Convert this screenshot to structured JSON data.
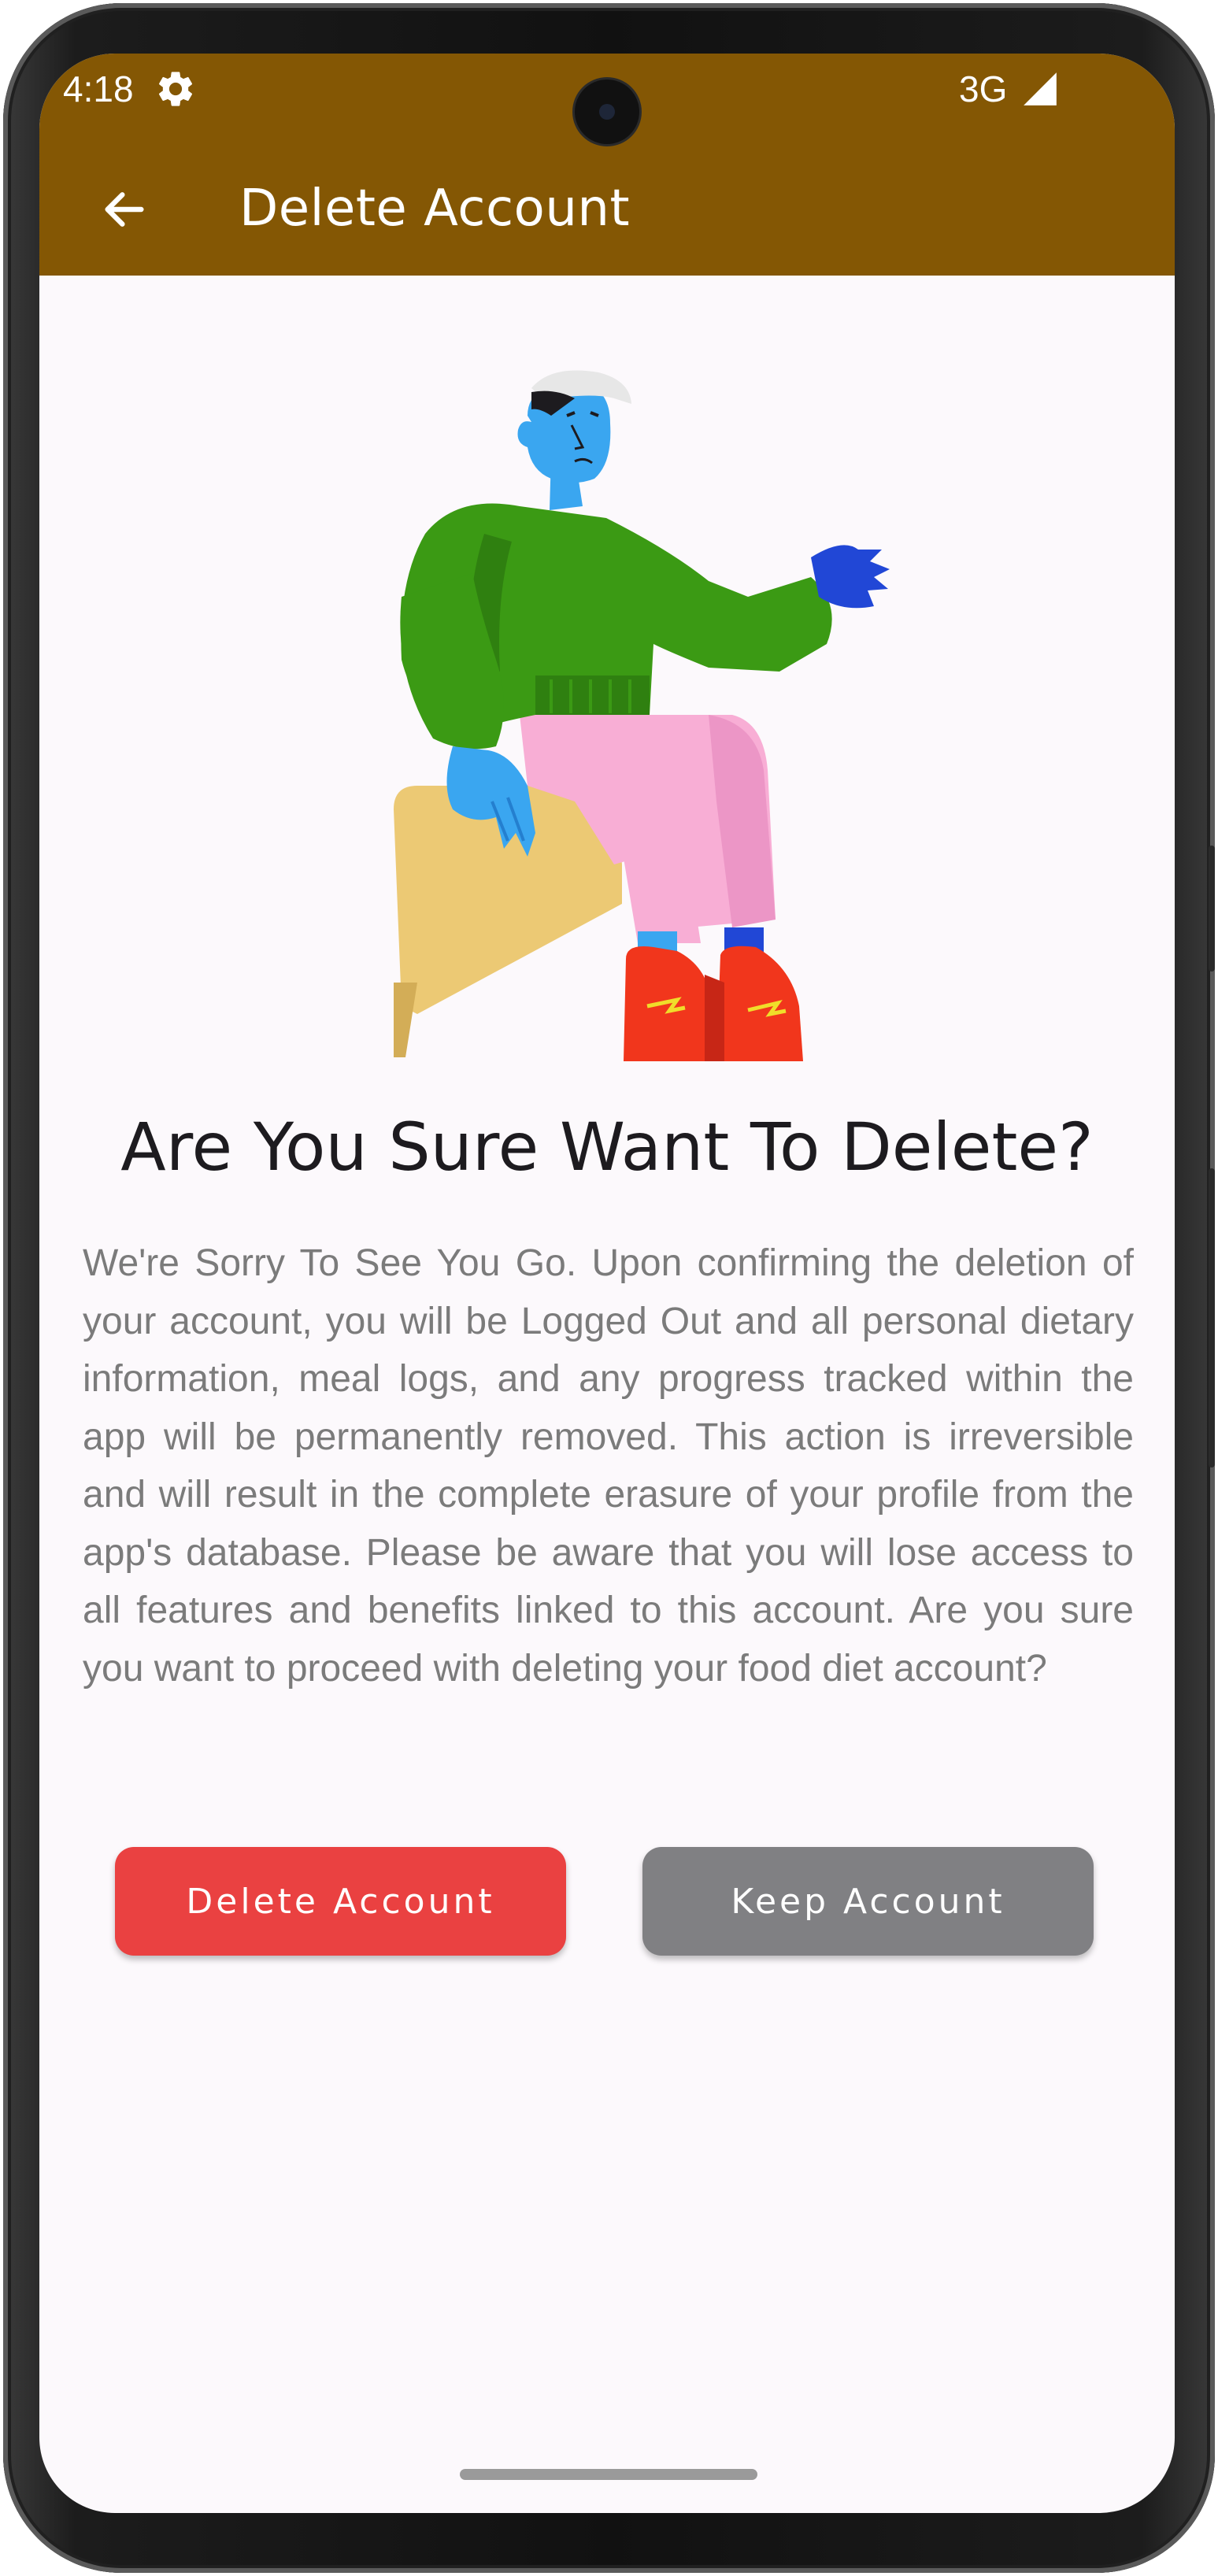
{
  "status_bar": {
    "time": "4:18",
    "network": "3G",
    "icons": [
      "gear-icon",
      "signal-icon"
    ]
  },
  "app_bar": {
    "back_icon": "arrow-left-icon",
    "title": "Delete Account",
    "background": "#845704"
  },
  "illustration": {
    "description_icon": "sitting-person-illustration"
  },
  "content": {
    "heading": "Are You Sure Want To Delete?",
    "body": "We're Sorry To See You Go. Upon confirming the deletion of your account, you will be Logged Out and all personal dietary information, meal logs, and any progress tracked within the app will be permanently removed. This action is irreversible and will result in the complete erasure of your profile from the app's database. Please be aware that you will lose access to all features and benefits linked to this account. Are you sure you want to proceed with deleting your food diet account?"
  },
  "actions": {
    "delete_label": "Delete Account",
    "delete_color": "#ea4141",
    "keep_label": "Keep Account",
    "keep_color": "#808083"
  }
}
